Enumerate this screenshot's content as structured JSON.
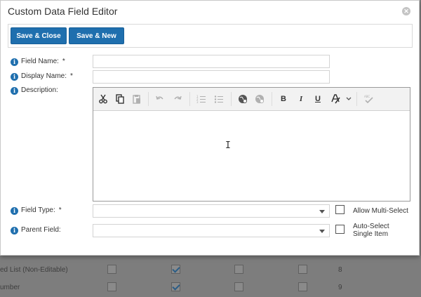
{
  "background_table": {
    "rows": [
      {
        "label": "ed List (Non-Editable)",
        "checks": [
          false,
          true,
          false,
          false
        ],
        "number": "8"
      },
      {
        "label": "umber",
        "checks": [
          false,
          true,
          false,
          false
        ],
        "number": "9"
      }
    ]
  },
  "dialog": {
    "title": "Custom Data Field Editor",
    "close_icon": "close-circle-icon",
    "buttons": {
      "save_close": "Save & Close",
      "save_new": "Save & New"
    },
    "fields": {
      "field_name": {
        "label": "Field Name:",
        "required": "*",
        "value": ""
      },
      "display_name": {
        "label": "Display Name:",
        "required": "*",
        "value": ""
      },
      "description": {
        "label": "Description:",
        "value": ""
      },
      "field_type": {
        "label": "Field Type:",
        "required": "*",
        "value": ""
      },
      "parent_field": {
        "label": "Parent Field:",
        "value": ""
      }
    },
    "options": {
      "allow_multi_select": {
        "label": "Allow Multi-Select",
        "checked": false
      },
      "auto_select_single": {
        "label_line1": "Auto-Select",
        "label_line2": "Single Item",
        "checked": false
      }
    },
    "editor_toolbar": {
      "tools": [
        "cut-icon",
        "copy-icon",
        "paste-icon",
        "undo-icon",
        "redo-icon",
        "ordered-list-icon",
        "unordered-list-icon",
        "insert-link-icon",
        "remove-link-icon",
        "bold-icon",
        "italic-icon",
        "underline-icon",
        "font-color-icon",
        "dropdown-chevron-icon",
        "spellcheck-icon"
      ],
      "bold": "B",
      "italic": "I",
      "underline": "U"
    },
    "colors": {
      "primary": "#1f6fae",
      "info": "#1f6fae"
    }
  }
}
